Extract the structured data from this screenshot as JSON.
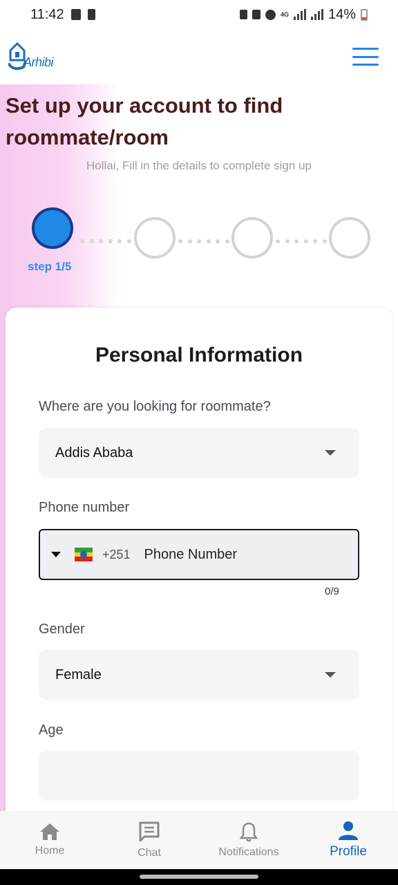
{
  "status_bar": {
    "time": "11:42",
    "network": "4G",
    "battery": "14%"
  },
  "header": {
    "logo_text": "Arhibi"
  },
  "page": {
    "title": "Set up your account to find roommate/room",
    "subtitle": "Hollai, Fill in the details to complete sign up"
  },
  "stepper": {
    "label": "step 1/5",
    "current_step": 1,
    "total_steps": 5
  },
  "form": {
    "title": "Personal Information",
    "location_label": "Where are you looking for roommate?",
    "location_value": "Addis Ababa",
    "phone_label": "Phone number",
    "phone_dial_code": "+251",
    "phone_placeholder": "Phone Number",
    "phone_counter": "0/9",
    "gender_label": "Gender",
    "gender_value": "Female",
    "age_label": "Age"
  },
  "bottom_nav": {
    "items": [
      {
        "label": "Home",
        "icon": "home-icon"
      },
      {
        "label": "Chat",
        "icon": "chat-icon"
      },
      {
        "label": "Notifications",
        "icon": "bell-icon"
      },
      {
        "label": "Profile",
        "icon": "person-icon"
      }
    ],
    "active": "Profile"
  },
  "colors": {
    "accent": "#1e88e5",
    "title": "#4a1c1c",
    "active_nav": "#1565c0"
  }
}
